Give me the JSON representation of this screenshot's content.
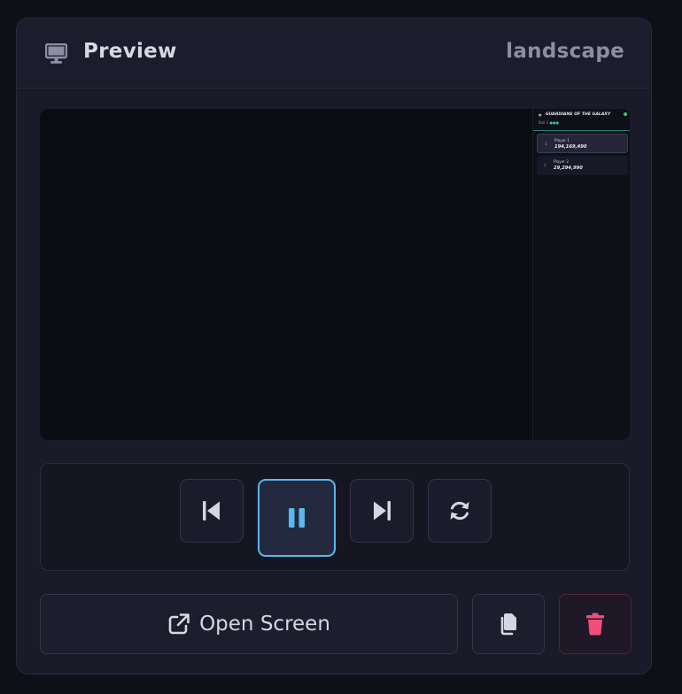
{
  "header": {
    "icon": "monitor-icon",
    "title": "Preview",
    "orientation": "landscape"
  },
  "preview": {
    "panel": {
      "title": "GUARDIANS OF THE GALAXY",
      "ball_label": "Ball 3",
      "ball_indicator": "●●●",
      "status_color": "#2ecc71",
      "players": [
        {
          "rank": "1",
          "name": "Player 1",
          "score": "194,169,490",
          "active": true
        },
        {
          "rank": "2",
          "name": "Player 2",
          "score": "29,294,990",
          "active": false
        }
      ]
    }
  },
  "controls": {
    "previous": {
      "icon": "skip-back-icon"
    },
    "pause": {
      "icon": "pause-icon",
      "active": true
    },
    "next": {
      "icon": "skip-forward-icon"
    },
    "refresh": {
      "icon": "refresh-icon"
    }
  },
  "actions": {
    "open_screen": {
      "label": "Open Screen",
      "icon": "external-link-icon"
    },
    "copy": {
      "icon": "copy-icon"
    },
    "delete": {
      "icon": "trash-icon"
    }
  },
  "colors": {
    "accent": "#59b9ee",
    "danger": "#ef4f7a",
    "teal": "#37c8a8"
  }
}
